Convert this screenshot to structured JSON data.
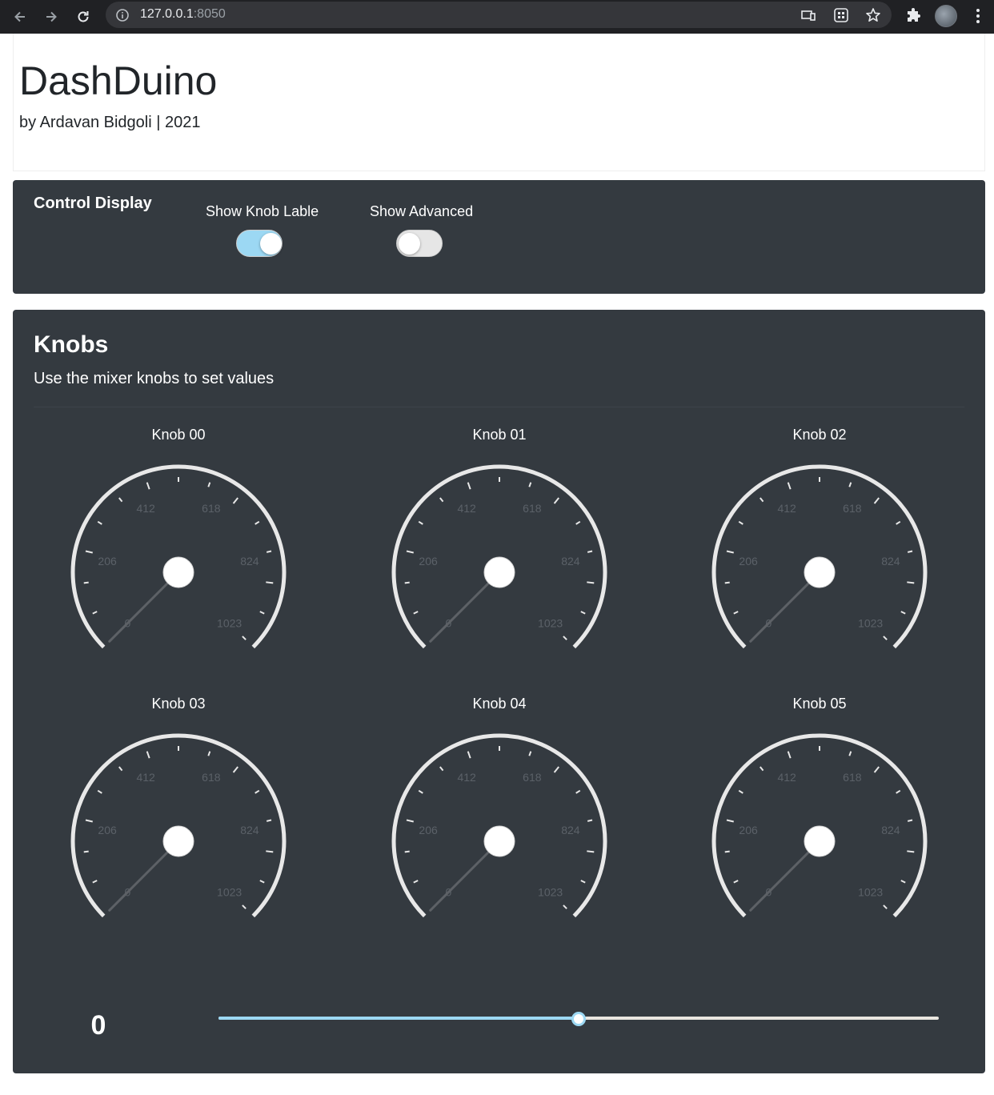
{
  "browser": {
    "url_host": "127.0.0.1",
    "url_port": ":8050"
  },
  "header": {
    "title": "DashDuino",
    "byline": "by Ardavan Bidgoli | 2021"
  },
  "control_display": {
    "title": "Control Display",
    "toggles": [
      {
        "label": "Show Knob Lable",
        "on": true
      },
      {
        "label": "Show Advanced",
        "on": false
      }
    ],
    "toggle_on_color": "#9cd8f3",
    "toggle_off_color": "#e6e6e6"
  },
  "knobs_section": {
    "title": "Knobs",
    "subtitle": "Use the mixer knobs to set values",
    "scale_labels": [
      "0",
      "206",
      "412",
      "618",
      "824",
      "1023"
    ],
    "min": 0,
    "max": 1023,
    "knobs": [
      {
        "label": "Knob 00",
        "value": 0
      },
      {
        "label": "Knob 01",
        "value": 0
      },
      {
        "label": "Knob 02",
        "value": 0
      },
      {
        "label": "Knob 03",
        "value": 0
      },
      {
        "label": "Knob 04",
        "value": 0
      },
      {
        "label": "Knob 05",
        "value": 0
      }
    ]
  },
  "value_display": "0",
  "slider": {
    "fraction": 0.5,
    "accent_color": "#9cd8f3"
  },
  "colors": {
    "card_bg": "#343a40",
    "gauge_ring": "#e8e8e8",
    "gauge_label": "#5b6168"
  }
}
